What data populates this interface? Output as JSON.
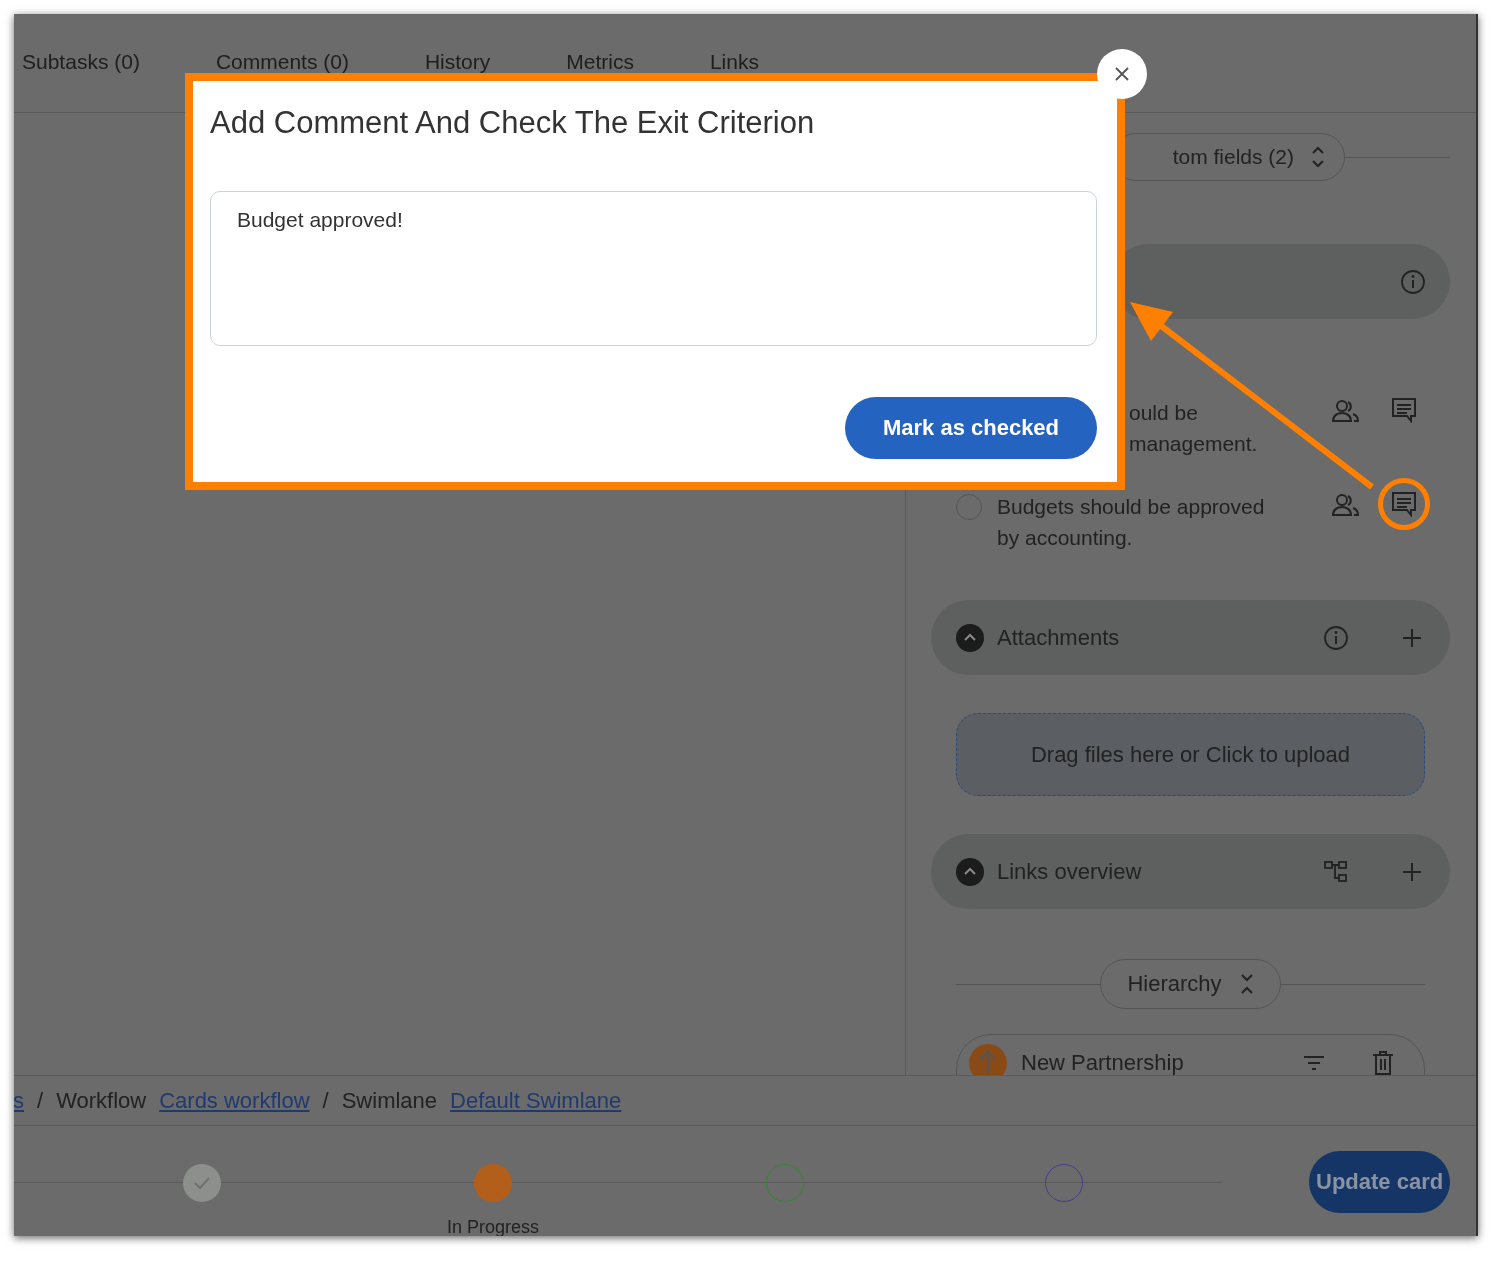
{
  "tabs": [
    {
      "label": "Subtasks (0)"
    },
    {
      "label": "Comments (0)"
    },
    {
      "label": "History"
    },
    {
      "label": "Metrics"
    },
    {
      "label": "Links"
    }
  ],
  "custom_fields_toggle": "tom fields (2)",
  "exit_criteria": [
    {
      "lines": [
        "ould be",
        "management."
      ],
      "highlighted": false
    },
    {
      "lines": [
        "Budgets should be approved",
        "by accounting."
      ],
      "checked": false,
      "highlighted": true
    }
  ],
  "attachments": {
    "title": "Attachments",
    "dropzone": "Drag files here or Click to upload"
  },
  "links_overview": {
    "title": "Links overview"
  },
  "hierarchy": {
    "toggle": "Hierarchy",
    "items": [
      {
        "name": "New Partnership"
      }
    ]
  },
  "breadcrumb": [
    {
      "text": "s",
      "kind": "link"
    },
    {
      "text": "/",
      "kind": "separator"
    },
    {
      "text": "Workflow",
      "kind": "label"
    },
    {
      "text": "Cards workflow",
      "kind": "link"
    },
    {
      "text": "/",
      "kind": "separator"
    },
    {
      "text": "Swimlane",
      "kind": "label"
    },
    {
      "text": "Default Swimlane",
      "kind": "link"
    }
  ],
  "stages": [
    {
      "kind": "done",
      "color": "#8c8f8c"
    },
    {
      "kind": "current",
      "color": "#b35f1c",
      "label": "In Progress"
    },
    {
      "kind": "upcoming",
      "color": "#2f8a2f"
    },
    {
      "kind": "upcoming",
      "color": "#4b3a8e"
    }
  ],
  "update_button": "Update card",
  "modal": {
    "title": "Add Comment And Check The Exit Criterion",
    "comment": {
      "value": "Budget approved!"
    },
    "submit_button": "Mark as checked"
  }
}
